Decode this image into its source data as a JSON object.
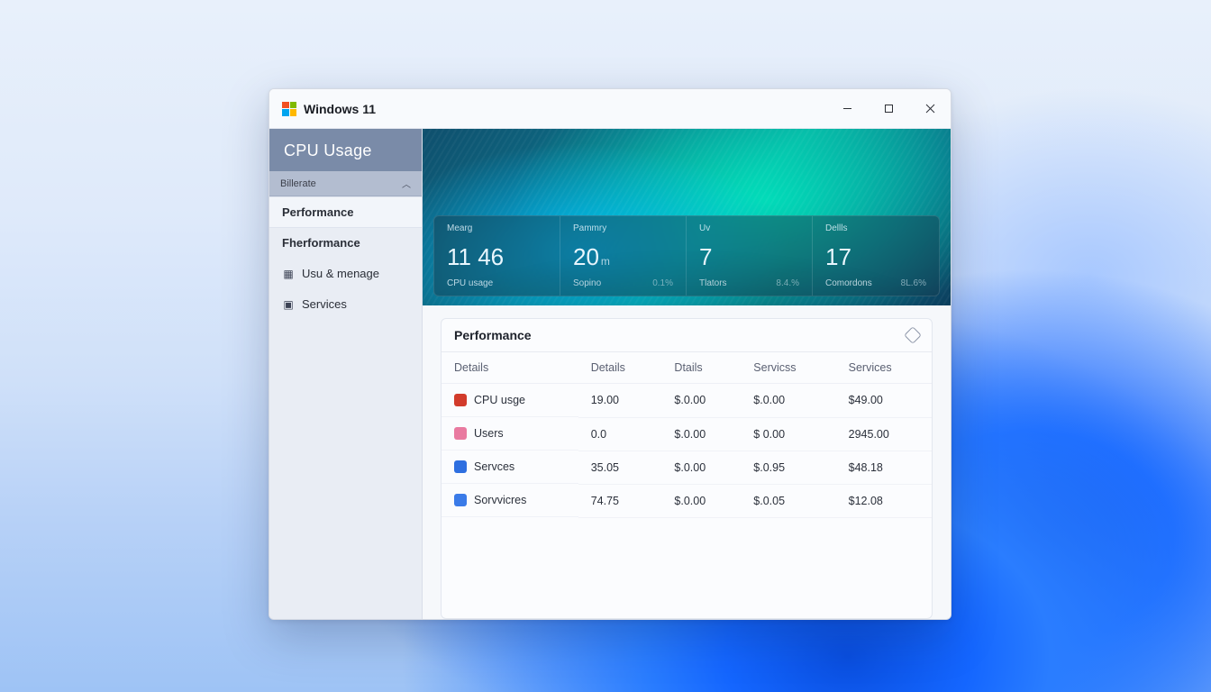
{
  "titlebar": {
    "title": "Windows 11"
  },
  "sidebar": {
    "header": "CPU Usage",
    "dropdown": "Billerate",
    "items": [
      {
        "label": "Performance"
      },
      {
        "label": "Fherformance"
      },
      {
        "label": "Usu & menage"
      },
      {
        "label": "Services"
      }
    ]
  },
  "stats": [
    {
      "top": "Mearg",
      "value": "11 46",
      "unit": "",
      "sub_l": "CPU usage",
      "sub_r": ""
    },
    {
      "top": "Pammry",
      "value": "20",
      "unit": "m",
      "sub_l": "Sopino",
      "sub_r": "0.1%"
    },
    {
      "top": "Uv",
      "value": "7",
      "unit": "",
      "sub_l": "Tlators",
      "sub_r": "8.4.%"
    },
    {
      "top": "Dellls",
      "value": "17",
      "unit": "",
      "sub_l": "Comordons",
      "sub_r": "8L.6%"
    }
  ],
  "panel": {
    "title": "Performance",
    "columns": [
      "Details",
      "Details",
      "Dtails",
      "Servicss",
      "Services"
    ],
    "rows": [
      {
        "name": "CPU usge",
        "iconClass": "ico-red",
        "c1": "19.00",
        "c2": "$.0.00",
        "c3": "$.0.00",
        "c4": "$49.00"
      },
      {
        "name": "Users",
        "iconClass": "ico-pink",
        "c1": "0.0",
        "c2": "$.0.00",
        "c3": "$ 0.00",
        "c4": "2945.00"
      },
      {
        "name": "Servces",
        "iconClass": "ico-blue",
        "c1": "35.05",
        "c2": "$.0.00",
        "c3": "$.0.95",
        "c4": "$48.18"
      },
      {
        "name": "Sorvvicres",
        "iconClass": "ico-blue2",
        "c1": "74.75",
        "c2": "$.0.00",
        "c3": "$.0.05",
        "c4": "$12.08"
      }
    ]
  }
}
